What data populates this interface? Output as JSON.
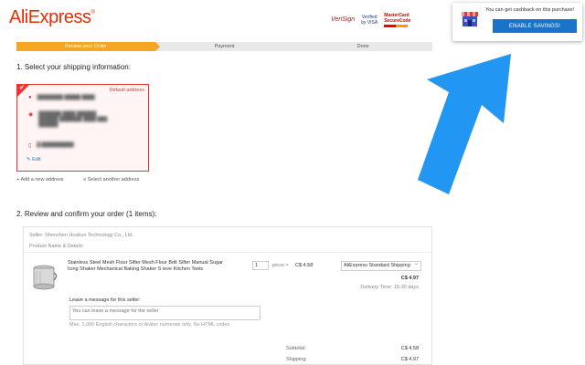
{
  "logo": {
    "text": "AliExpress",
    "mark": "®"
  },
  "payment_badges": [
    "VeriSign",
    "Verified by VISA",
    "MasterCard SecureCode"
  ],
  "cashback": {
    "icon": "store-icon",
    "text": "You can get cashback on this purchase!",
    "button": "ENABLE SAVINGS!"
  },
  "steps": [
    {
      "label": "Review your Order",
      "active": true
    },
    {
      "label": "Payment",
      "active": false
    },
    {
      "label": "Done",
      "active": false
    }
  ],
  "section1": {
    "title": "1. Select your shipping information:",
    "default_label": "Default address",
    "edit": "Edit",
    "add_new": "Add a new address",
    "select_another": "Select another address"
  },
  "section2": {
    "title": "2. Review and confirm your order (1 items):",
    "seller": "Seller: Shenzhen Huakun Technology Co., Ltd.",
    "product_header": "Product Name & Details",
    "product_name": "Stainless Steel Mesh Flour Sifter Mesh Flour Bolt Sifter Manual Sugar Icing Shaker Mechanical Baking Shaker S ieve Kitchen Tools",
    "quantity": "1",
    "qty_unit": "piece",
    "unit_price": "C$ 4.58",
    "shipping_method": "AliExpress Standard Shipping",
    "shipping_price": "C$ 4.97",
    "delivery_time": "Delivery Time: 15-30 days",
    "message_label": "Leave a message for this seller:",
    "message_placeholder": "You can leave a message for the seller",
    "message_hint": "Max. 1,000 English characters or Arabic numerals only. No HTML codes.",
    "subtotal_label": "Subtotal:",
    "subtotal_value": "C$ 4.58",
    "shipping_label": "Shipping:",
    "shipping_value": "C$ 4.97"
  },
  "colors": {
    "brand": "#e62e04",
    "active_step": "#f5a623",
    "button": "#1a73c9",
    "arrow": "#2196f3",
    "address_border": "#e33333"
  }
}
